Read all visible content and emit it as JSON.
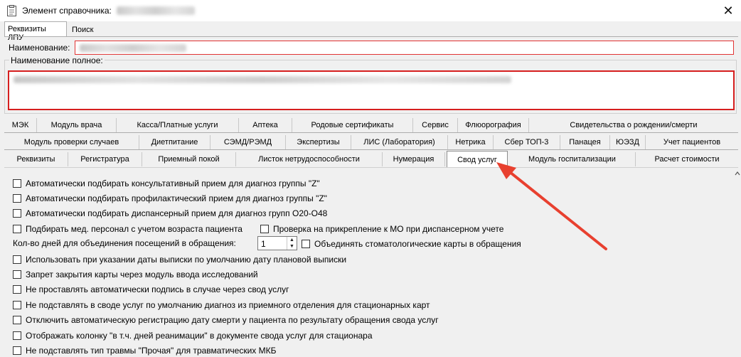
{
  "window": {
    "title": "Элемент справочника:",
    "close_symbol": "✕"
  },
  "outer_tabs": [
    "Реквизиты ЛПУ",
    "Поиск"
  ],
  "fields": {
    "name_label": "Наименование:",
    "full_name_label": "Наименование полное:"
  },
  "tab_rows": {
    "row1": [
      "МЭК",
      "Модуль врача",
      "Касса/Платные услуги",
      "Аптека",
      "Родовые сертификаты",
      "Сервис",
      "Флюорография",
      "Свидетельства о рождении/смерти"
    ],
    "row2": [
      "Модуль проверки случаев",
      "Диетпитание",
      "СЭМД/РЭМД",
      "Экспертизы",
      "ЛИС (Лаборатория)",
      "Нетрика",
      "Сбер ТОП-3",
      "Панацея",
      "ЮЭЗД",
      "Учет пациентов"
    ],
    "row3": [
      "Реквизиты",
      "Регистратура",
      "Приемный покой",
      "Листок нетрудоспособности",
      "Нумерация",
      "Свод услуг",
      "Модуль госпитализации",
      "Расчет стоимости"
    ]
  },
  "active_tab": "Свод услуг",
  "options": {
    "o1": "Автоматически подбирать консультативный прием для диагноз группы \"Z\"",
    "o2": "Автоматически подбирать профилактический прием для диагноз группы \"Z\"",
    "o3": "Автоматически подбирать диспансерный прием для диагноз групп O20-O48",
    "o4": "Подбирать мед. персонал с учетом возраста пациента",
    "o4b": "Проверка на прикрепление к МО при диспансерном учете",
    "spin_label": "Кол-во дней для объединения посещений в обращения:",
    "spin_value": "1",
    "o5b": "Объединять стоматологические карты в обращения",
    "o6": "Использовать при указании даты выписки по умолчанию дату плановой выписки",
    "o7": "Запрет закрытия карты через модуль ввода исследований",
    "o8": "Не проставлять автоматически подпись в случае через свод услуг",
    "o9": "Не подставлять в своде услуг по умолчанию диагноз из приемного отделения для стационарных карт",
    "o10": "Отключить автоматическую регистрацию дату смерти у пациента по результату обращения свода услуг",
    "o11": "Отображать колонку \"в т.ч. дней реанимации\" в документе свода услуг для стационара",
    "o12": "Не подставлять тип травмы \"Прочая\" для травматических МКБ"
  },
  "colors": {
    "accent_red": "#e8402f",
    "invalid_border": "#d61f1f"
  }
}
